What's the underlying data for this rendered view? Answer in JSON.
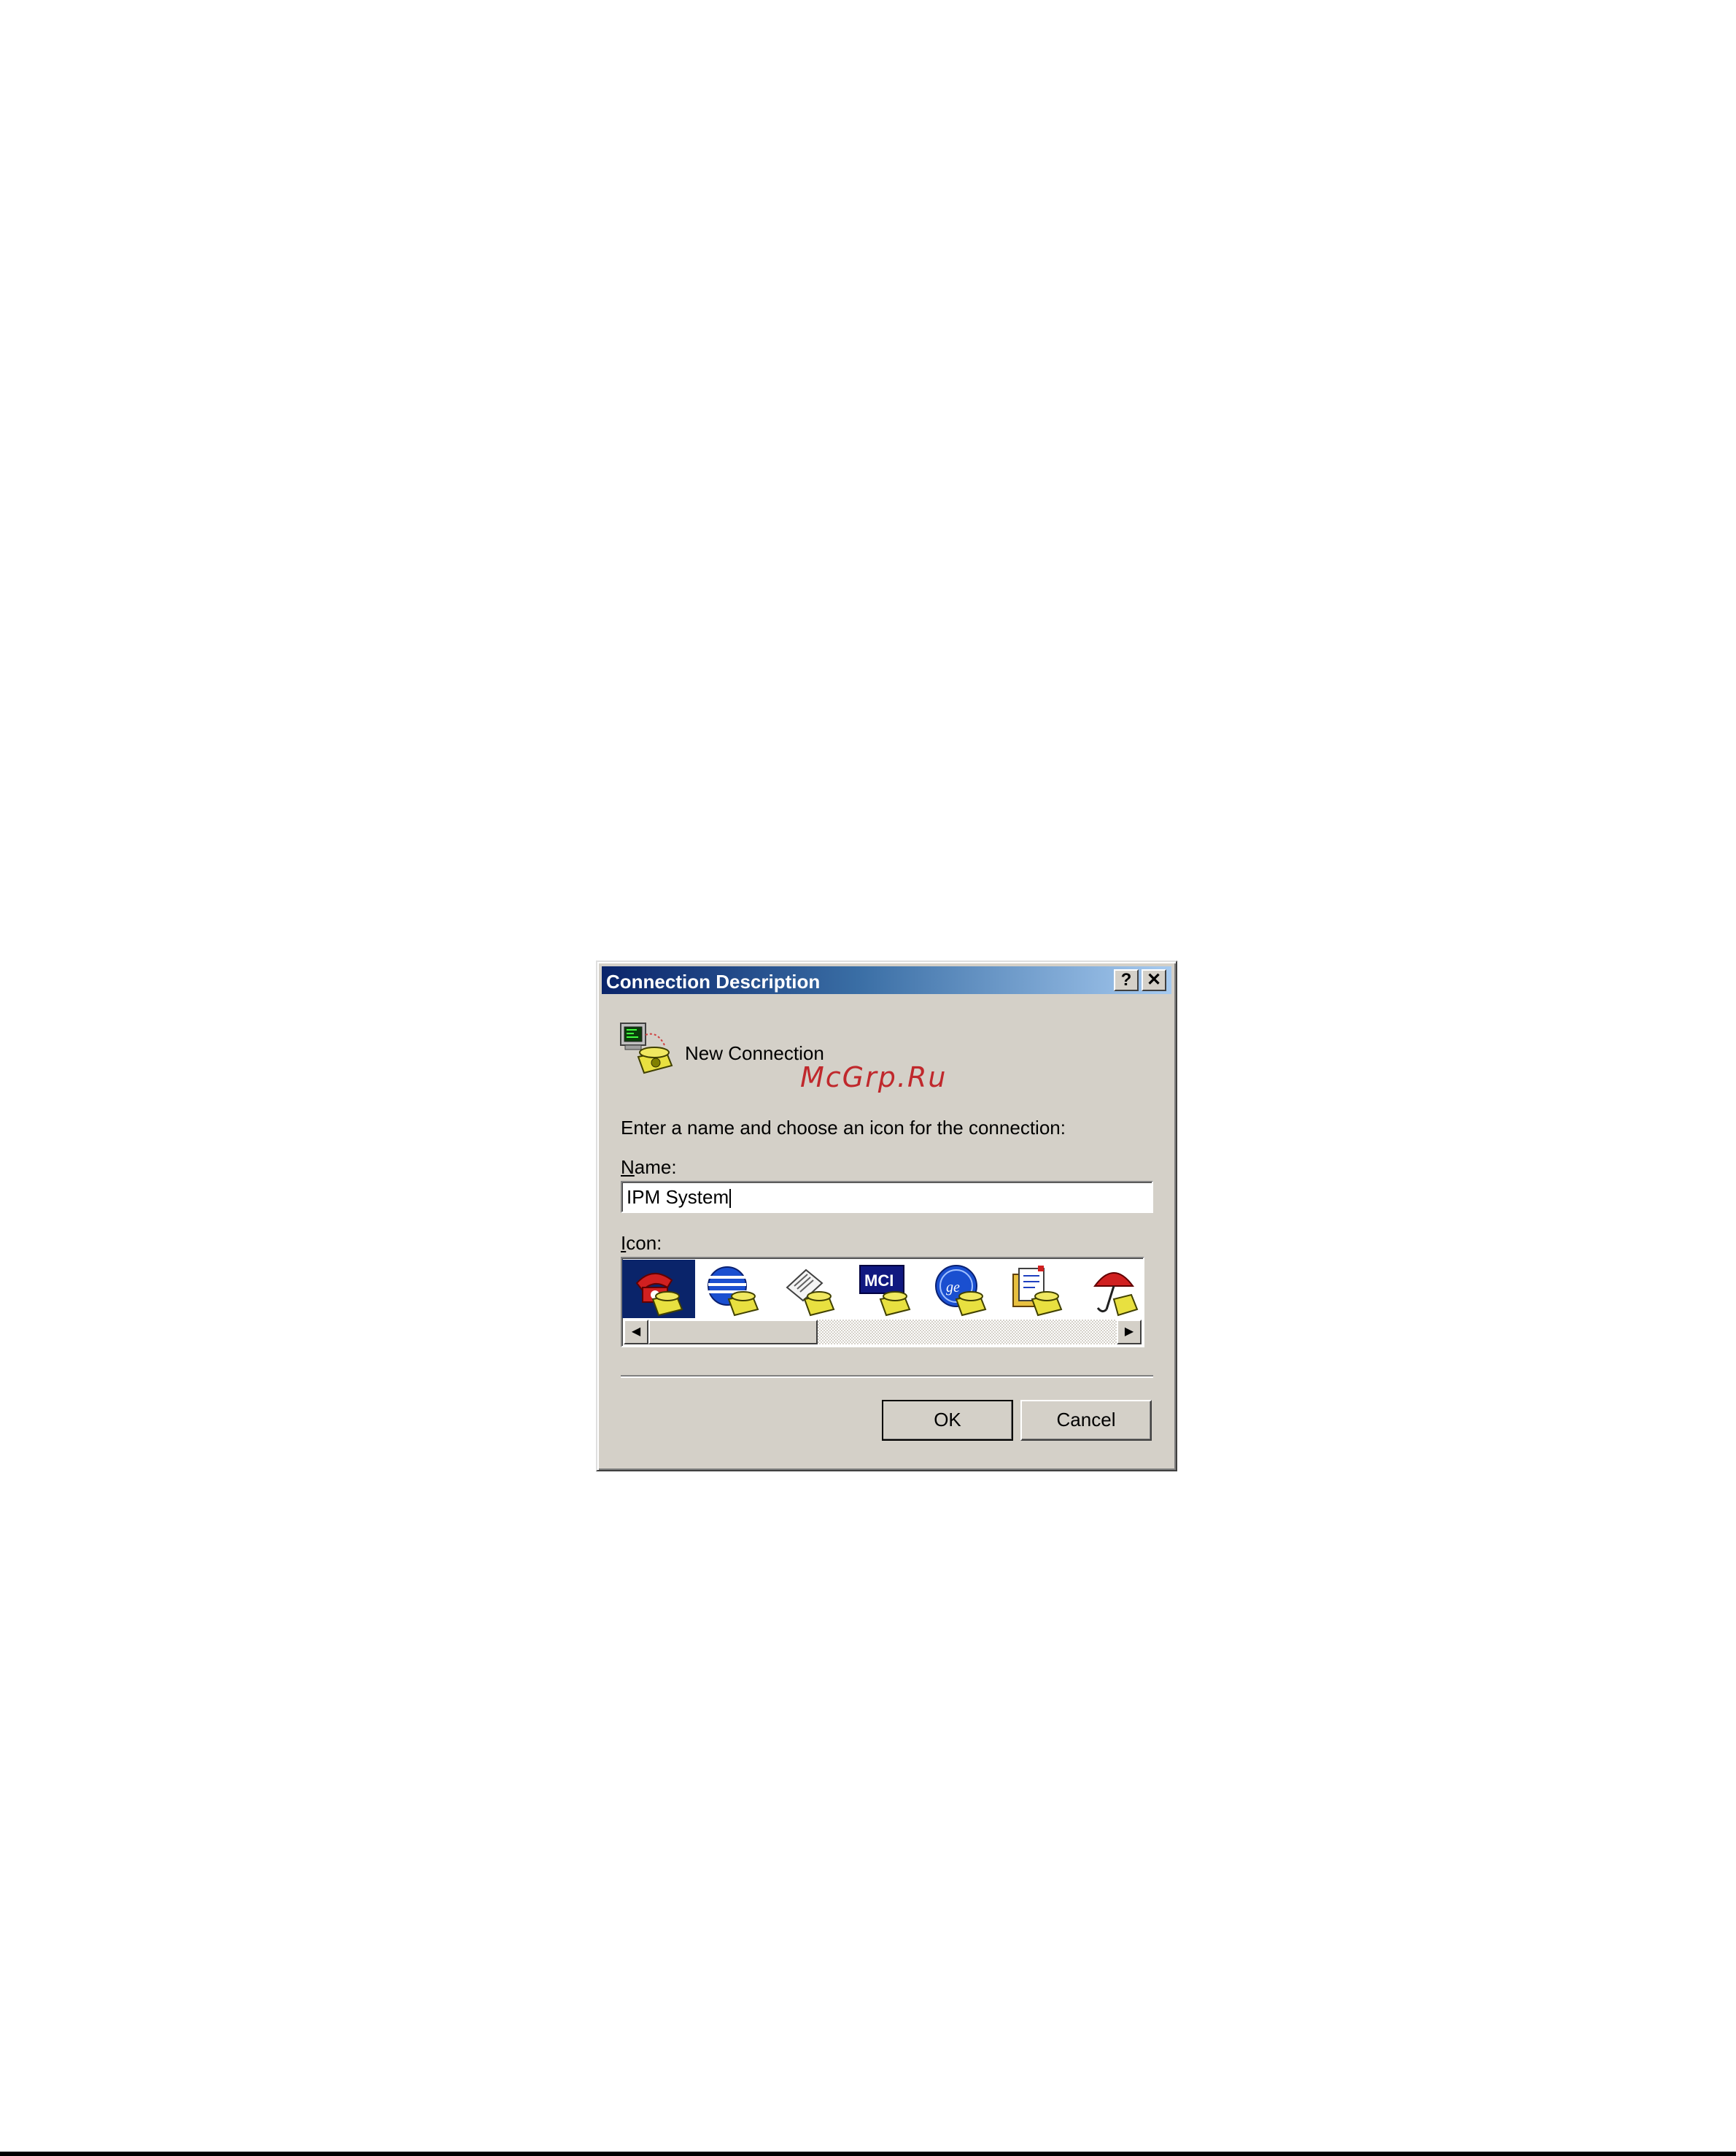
{
  "dialog": {
    "title": "Connection Description",
    "help_label": "?",
    "close_label": "✕",
    "connection_label": "New Connection",
    "watermark": "McGrp.Ru",
    "instructions": "Enter a name and choose an icon for the connection:",
    "name_label": "Name:",
    "name_value": "IPM System",
    "icon_label": "Icon:",
    "icons": [
      "red-phone-icon",
      "globe-phone-icon",
      "newspaper-phone-icon",
      "mci-phone-icon",
      "ge-phone-icon",
      "documents-phone-icon",
      "umbrella-phone-icon"
    ],
    "selected_icon_index": 0,
    "ok_label": "OK",
    "cancel_label": "Cancel"
  },
  "colors": {
    "title_start": "#0a246a",
    "title_end": "#a6caf0",
    "dialog_bg": "#d4d0c8",
    "watermark": "#c0282c"
  }
}
